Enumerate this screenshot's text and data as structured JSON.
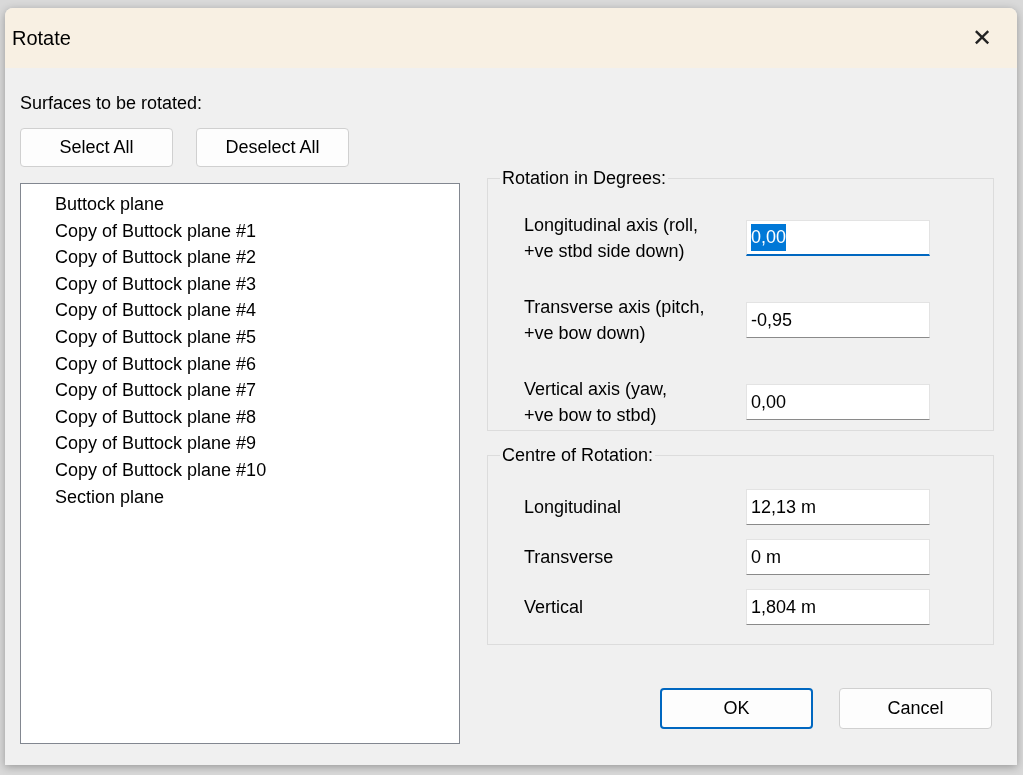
{
  "window": {
    "title": "Rotate",
    "close": "✕"
  },
  "surfaces": {
    "label": "Surfaces to be rotated:",
    "buttons": [
      "Select All",
      "Deselect All"
    ],
    "items": [
      {
        "label": "Buttock plane",
        "selected": false
      },
      {
        "label": "Copy of Buttock plane #1",
        "selected": false
      },
      {
        "label": "Copy of Buttock plane #2",
        "selected": false
      },
      {
        "label": "Copy of Buttock plane #3",
        "selected": false
      },
      {
        "label": "Copy of Buttock plane #4",
        "selected": false
      },
      {
        "label": "Copy of Buttock plane #5",
        "selected": false
      },
      {
        "label": "Copy of Buttock plane #6",
        "selected": false
      },
      {
        "label": "Copy of Buttock plane #7",
        "selected": false
      },
      {
        "label": "Copy of Buttock plane #8",
        "selected": false
      },
      {
        "label": "Copy of Buttock plane #9",
        "selected": false
      },
      {
        "label": "Copy of Buttock plane #10",
        "selected": false
      },
      {
        "label": "Section plane",
        "selected": false
      }
    ]
  },
  "rotation": {
    "title": "Rotation in Degrees:",
    "fields": [
      {
        "label": "Longitudinal axis (roll,\n+ve stbd side down)",
        "value": "0,00",
        "focused": true
      },
      {
        "label": "Transverse axis (pitch,\n+ve bow down)",
        "value": "-0,95",
        "focused": false
      },
      {
        "label": "Vertical axis (yaw,\n+ve bow to stbd)",
        "value": "0,00",
        "focused": false
      }
    ]
  },
  "centre": {
    "title": "Centre of Rotation:",
    "fields": [
      {
        "label": "Longitudinal",
        "value": "12,13 m",
        "focused": false
      },
      {
        "label": "Transverse",
        "value": "0 m",
        "focused": false
      },
      {
        "label": "Vertical",
        "value": "1,804 m",
        "focused": false
      }
    ]
  },
  "buttons": [
    {
      "label": "OK",
      "default": true
    },
    {
      "label": "Cancel",
      "default": false
    }
  ]
}
